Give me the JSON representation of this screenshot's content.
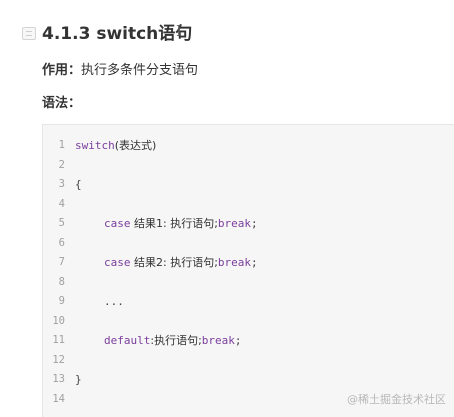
{
  "heading": {
    "title": "4.1.3 switch语句"
  },
  "purpose": {
    "label": "作用：",
    "text": "执行多条件分支语句"
  },
  "syntax": {
    "label": "语法："
  },
  "code": {
    "lines": [
      {
        "num": "1",
        "kw": "switch",
        "rest": "(表达式)"
      },
      {
        "num": "2"
      },
      {
        "num": "3",
        "rest": "{"
      },
      {
        "num": "4"
      },
      {
        "num": "5",
        "kw": "case",
        "rest": " 结果1: 执行语句;",
        "kw2": "break",
        "tail": ";"
      },
      {
        "num": "6"
      },
      {
        "num": "7",
        "kw": "case",
        "rest": " 结果2: 执行语句;",
        "kw2": "break",
        "tail": ";"
      },
      {
        "num": "8"
      },
      {
        "num": "9",
        "rest": "..."
      },
      {
        "num": "10"
      },
      {
        "num": "11",
        "kw": "default",
        "rest": ":执行语句;",
        "kw2": "break",
        "tail": ";"
      },
      {
        "num": "12"
      },
      {
        "num": "13",
        "rest": "}"
      },
      {
        "num": "14"
      }
    ]
  },
  "watermark": {
    "text": "@稀土掘金技术社区"
  }
}
